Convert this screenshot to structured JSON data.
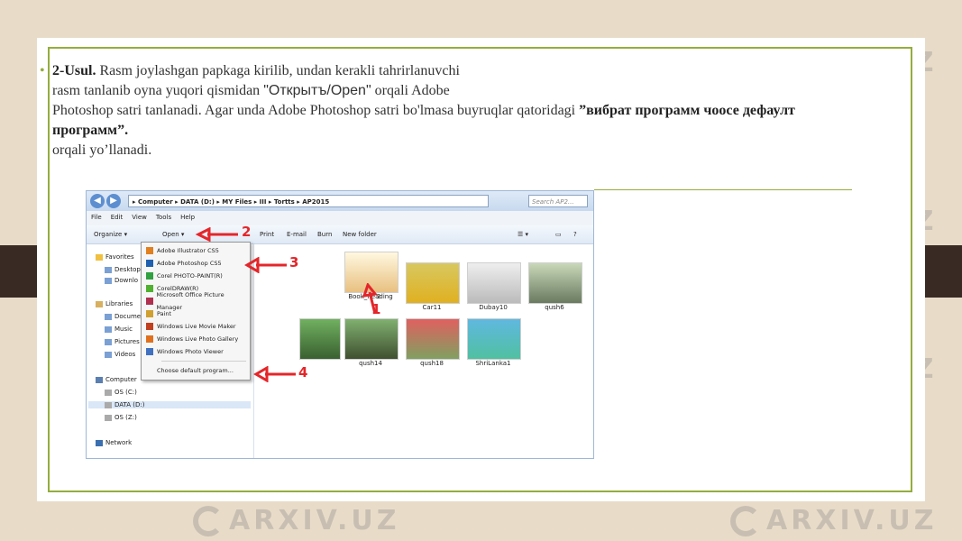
{
  "watermark": "ARXIV.UZ",
  "text": {
    "bullet": "•",
    "method_label": "2-Usul.",
    "line1": " Rasm joylashgan papkaga kirilib, undan kerakli tahrirlanuvchi",
    "line2": "rasm tanlanib oyna yuqori qismidan ",
    "open_quote": "\"Открытъ/Open\"",
    "line2b": " orqali Adobe",
    "line3": "Photoshop satri tanlanadi. Agar unda Adobe Photoshop satri bo'lmasa buyruqlar qatoridagi ",
    "bold_cyr": "”вибрат программ чоосе дефаулт программ”.",
    "line4": "orqali yo’llanadi."
  },
  "explorer": {
    "address": "▸ Computer ▸ DATA (D:) ▸ MY Files ▸ III ▸ Tortts ▸ AP2015",
    "search_placeholder": "Search AP2...",
    "menu": [
      "File",
      "Edit",
      "View",
      "Tools",
      "Help"
    ],
    "toolbar": {
      "organize": "Organize ▾",
      "open": "Open ▾",
      "print": "Print",
      "email": "E-mail",
      "burn": "Burn",
      "new_folder": "New folder"
    },
    "nav": {
      "favorites": "Favorites",
      "desktop": "Desktop",
      "downloads": "Downlo",
      "libraries": "Libraries",
      "documents": "Docume",
      "music": "Music",
      "pictures": "Pictures",
      "videos": "Videos",
      "computer": "Computer",
      "os_c": "OS (C:)",
      "data_d": "DATA (D:)",
      "os_z": "OS (Z:)",
      "network": "Network"
    },
    "context_menu": [
      "Adobe Illustrator CS5",
      "Adobe Photoshop CS5",
      "Corel PHOTO-PAINT(R)",
      "CorelDRAW(R)",
      "Microsoft Office Picture Manager",
      "Paint",
      "Windows Live Movie Maker",
      "Windows Live Photo Gallery",
      "Windows Photo Viewer",
      "Choose default program..."
    ],
    "thumbnails_row1": [
      "2",
      "Book_Reading",
      "Car11",
      "Dubay10",
      "qush6"
    ],
    "thumbnails_row2": [
      "qush14",
      "qush18",
      "ShriLanka1"
    ],
    "markers": [
      "1",
      "2",
      "3",
      "4"
    ]
  },
  "colors": {
    "accent": "#94ad3c",
    "annotation": "#e4262a",
    "tab": "#3a2a24"
  }
}
